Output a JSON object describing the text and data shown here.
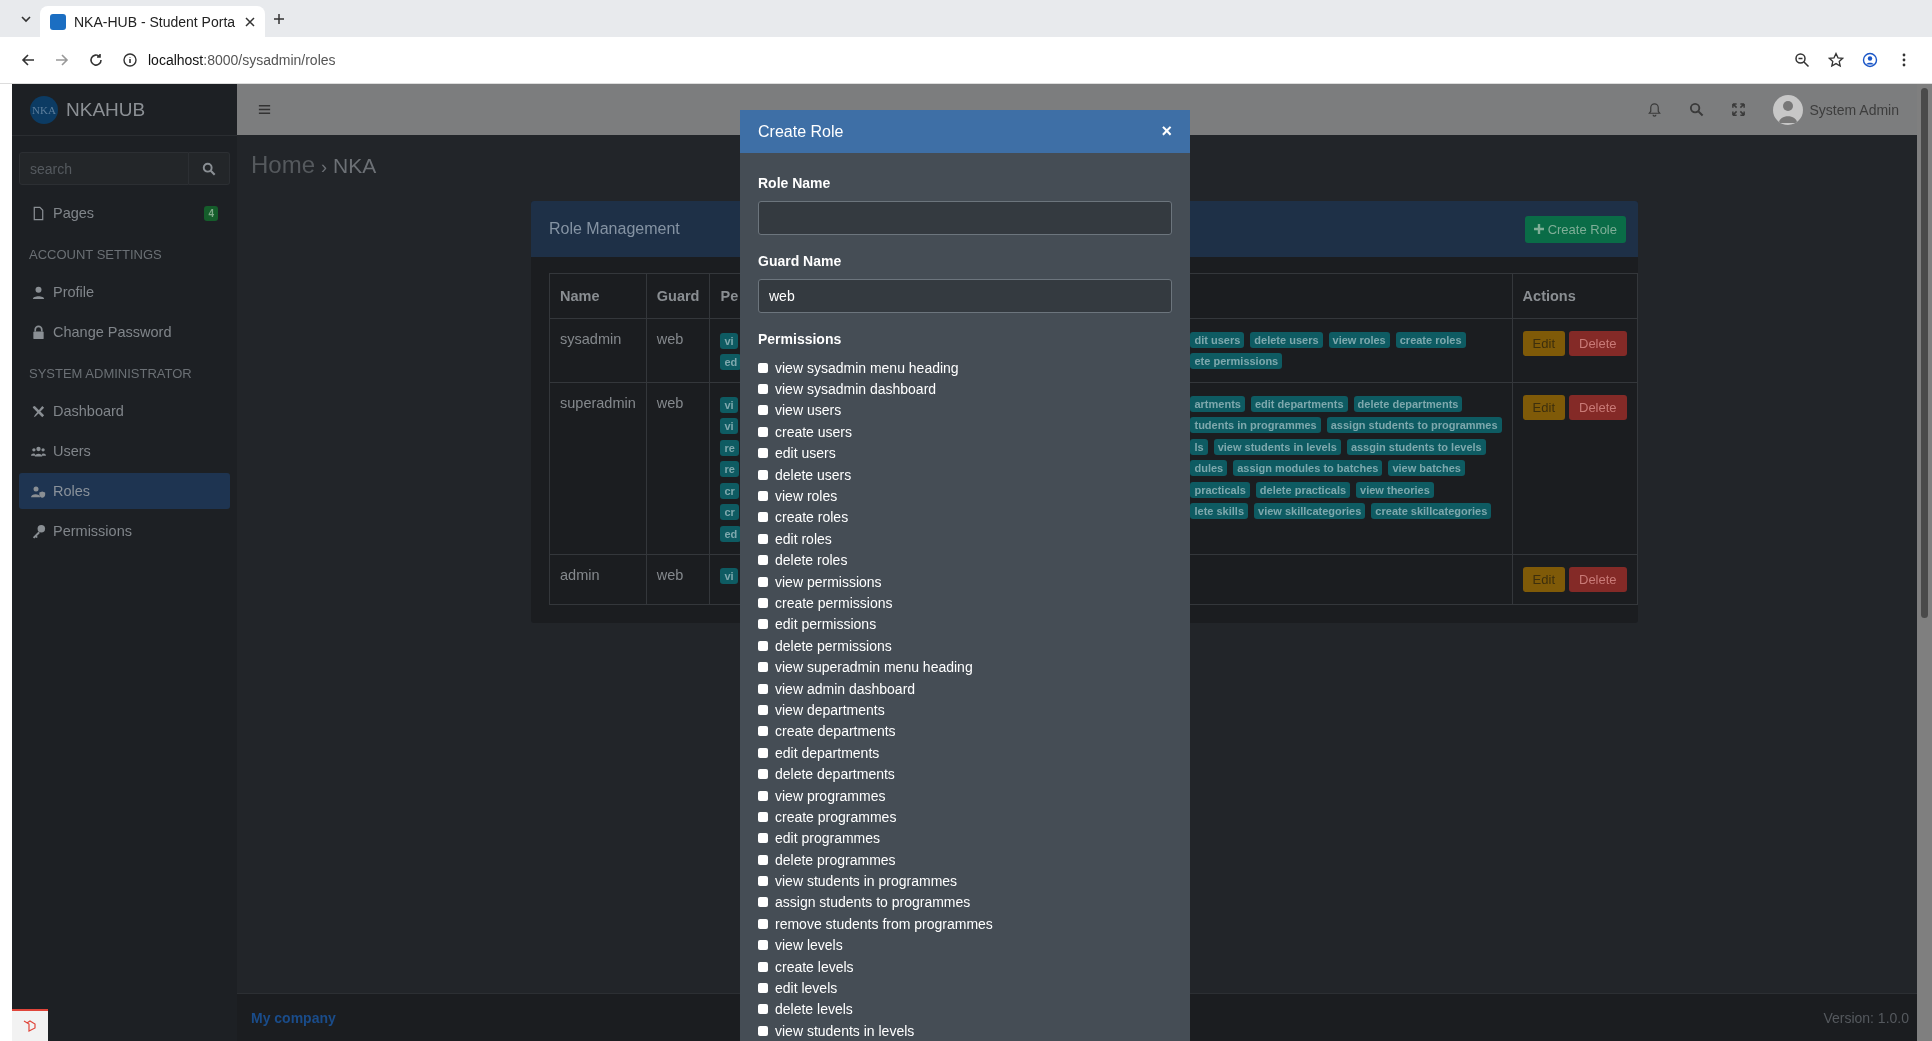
{
  "browser": {
    "tab_title": "NKA-HUB - Student Porta",
    "url_host": "localhost",
    "url_path": ":8000/sysadmin/roles"
  },
  "sidebar": {
    "logo": "NKA",
    "brand": "NKAHUB",
    "search": {
      "placeholder": "search"
    },
    "items": [
      {
        "kind": "link",
        "label": "Pages",
        "badge": "4",
        "selected": false
      },
      {
        "kind": "header",
        "label": "ACCOUNT SETTINGS"
      },
      {
        "kind": "link",
        "label": "Profile",
        "selected": false
      },
      {
        "kind": "link",
        "label": "Change Password",
        "selected": false
      },
      {
        "kind": "header",
        "label": "SYSTEM ADMINISTRATOR"
      },
      {
        "kind": "link",
        "label": "Dashboard",
        "selected": false
      },
      {
        "kind": "link",
        "label": "Users",
        "selected": false
      },
      {
        "kind": "link",
        "label": "Roles",
        "selected": true
      },
      {
        "kind": "link",
        "label": "Permissions",
        "selected": false
      }
    ]
  },
  "topbar": {
    "user": "System Admin"
  },
  "breadcrumb": {
    "home": "Home",
    "separator": "›",
    "current": "NKA"
  },
  "card": {
    "title": "Role Management",
    "create_button": "Create Role",
    "table": {
      "columns": [
        "Name",
        "Guard",
        "Pe",
        "Actions"
      ],
      "rows": [
        {
          "name": "sysadmin",
          "guard": "web",
          "edit": "Edit",
          "delete": "Delete",
          "permission_lines": [
            {
              "left": "vi",
              "right": [
                "dit users",
                "delete users",
                "view roles",
                "create roles"
              ]
            },
            {
              "left": "ed",
              "right": [
                "ete permissions"
              ]
            }
          ]
        },
        {
          "name": "superadmin",
          "guard": "web",
          "edit": "Edit",
          "delete": "Delete",
          "permission_lines": [
            {
              "left": "vi",
              "right": [
                "artments",
                "edit departments",
                "delete departments"
              ]
            },
            {
              "left": "vi",
              "right": [
                "tudents in programmes",
                "assign students to programmes"
              ]
            },
            {
              "left": "re",
              "right": [
                "ls",
                "view students in levels",
                "assgin students to levels"
              ]
            },
            {
              "left": "re",
              "right": [
                "dules",
                "assign modules to batches",
                "view batches"
              ]
            },
            {
              "left": "cr",
              "right": [
                "practicals",
                "delete practicals",
                "view theories"
              ]
            },
            {
              "left": "cr",
              "right": [
                "lete skills",
                "view skillcategories",
                "create skillcategories"
              ]
            },
            {
              "left": "ed"
            }
          ]
        },
        {
          "name": "admin",
          "guard": "web",
          "edit": "Edit",
          "delete": "Delete",
          "permission_lines": [
            {
              "left": "vi"
            }
          ]
        }
      ]
    }
  },
  "footer": {
    "company": "My company",
    "version": "Version: 1.0.0"
  },
  "modal": {
    "title": "Create Role",
    "close": "×",
    "role_name": {
      "label": "Role Name"
    },
    "guard_name": {
      "label": "Guard Name",
      "value": "web"
    },
    "permissions_label": "Permissions",
    "permissions": [
      {
        "label": "view sysadmin menu heading",
        "checked": false
      },
      {
        "label": "view sysadmin dashboard",
        "checked": false
      },
      {
        "label": "view users",
        "checked": false
      },
      {
        "label": "create users",
        "checked": false
      },
      {
        "label": "edit users",
        "checked": false
      },
      {
        "label": "delete users",
        "checked": false
      },
      {
        "label": "view roles",
        "checked": false
      },
      {
        "label": "create roles",
        "checked": false
      },
      {
        "label": "edit roles",
        "checked": false
      },
      {
        "label": "delete roles",
        "checked": false
      },
      {
        "label": "view permissions",
        "checked": false
      },
      {
        "label": "create permissions",
        "checked": false
      },
      {
        "label": "edit permissions",
        "checked": false
      },
      {
        "label": "delete permissions",
        "checked": false
      },
      {
        "label": "view superadmin menu heading",
        "checked": false
      },
      {
        "label": "view admin dashboard",
        "checked": false
      },
      {
        "label": "view departments",
        "checked": false
      },
      {
        "label": "create departments",
        "checked": false
      },
      {
        "label": "edit departments",
        "checked": false
      },
      {
        "label": "delete departments",
        "checked": false
      },
      {
        "label": "view programmes",
        "checked": false
      },
      {
        "label": "create programmes",
        "checked": false
      },
      {
        "label": "edit programmes",
        "checked": false
      },
      {
        "label": "delete programmes",
        "checked": false
      },
      {
        "label": "view students in programmes",
        "checked": false
      },
      {
        "label": "assign students to programmes",
        "checked": false
      },
      {
        "label": "remove students from programmes",
        "checked": false
      },
      {
        "label": "view levels",
        "checked": false
      },
      {
        "label": "create levels",
        "checked": false
      },
      {
        "label": "edit levels",
        "checked": false
      },
      {
        "label": "delete levels",
        "checked": false
      },
      {
        "label": "view students in levels",
        "checked": false
      }
    ]
  }
}
